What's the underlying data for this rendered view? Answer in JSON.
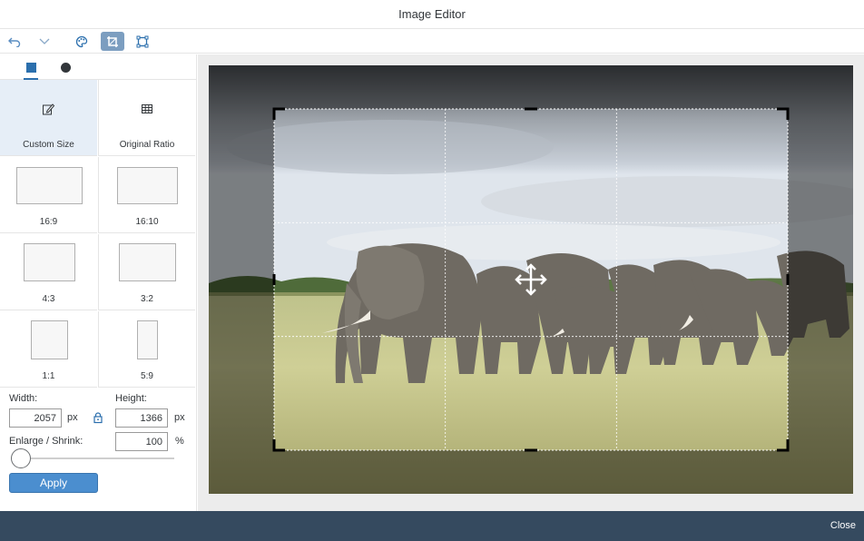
{
  "window": {
    "title": "Image Editor"
  },
  "toolbar": {
    "buttons": [
      {
        "name": "undo-icon"
      },
      {
        "name": "chevron-down-icon"
      },
      {
        "name": "palette-icon"
      },
      {
        "name": "crop-icon",
        "active": true
      },
      {
        "name": "resize-icon"
      }
    ]
  },
  "sidebar": {
    "tabs": [
      {
        "name": "rectangle-shape-tab",
        "selected": true
      },
      {
        "name": "circle-shape-tab",
        "selected": false
      }
    ],
    "ratios": [
      {
        "label": "Custom Size",
        "icon": "edit-icon",
        "selected": true
      },
      {
        "label": "Original Ratio",
        "icon": "table-icon",
        "selected": false
      },
      {
        "label": "16:9"
      },
      {
        "label": "16:10"
      },
      {
        "label": "4:3"
      },
      {
        "label": "3:2"
      },
      {
        "label": "1:1"
      },
      {
        "label": "5:9"
      }
    ],
    "form": {
      "width_label": "Width:",
      "height_label": "Height:",
      "width_value": "2057",
      "height_value": "1366",
      "px_unit": "px",
      "enlarge_label": "Enlarge / Shrink:",
      "scale_value": "100",
      "percent_unit": "%",
      "slider_fraction": 0.0,
      "apply_label": "Apply"
    }
  },
  "footer": {
    "close_label": "Close"
  },
  "colors": {
    "accent": "#4b8ecf",
    "footer": "#354a5f",
    "active_tool": "#7c9ec0"
  }
}
